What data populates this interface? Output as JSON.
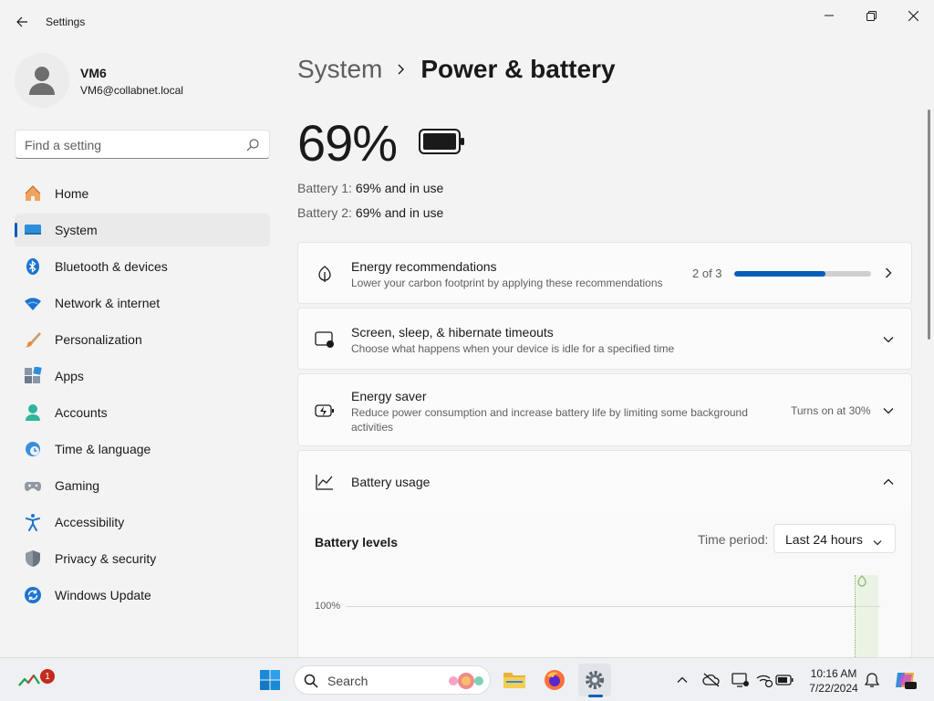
{
  "window": {
    "title": "Settings",
    "controls": [
      "minimize",
      "maximize",
      "close"
    ]
  },
  "profile": {
    "name": "VM6",
    "email": "VM6@collabnet.local"
  },
  "search": {
    "placeholder": "Find a setting"
  },
  "sidebar": {
    "items": [
      {
        "label": "Home",
        "icon": "home-icon"
      },
      {
        "label": "System",
        "icon": "system-icon",
        "active": true
      },
      {
        "label": "Bluetooth & devices",
        "icon": "bluetooth-icon"
      },
      {
        "label": "Network & internet",
        "icon": "wifi-icon"
      },
      {
        "label": "Personalization",
        "icon": "brush-icon"
      },
      {
        "label": "Apps",
        "icon": "apps-icon"
      },
      {
        "label": "Accounts",
        "icon": "accounts-icon"
      },
      {
        "label": "Time & language",
        "icon": "clock-globe-icon"
      },
      {
        "label": "Gaming",
        "icon": "gamepad-icon"
      },
      {
        "label": "Accessibility",
        "icon": "accessibility-icon"
      },
      {
        "label": "Privacy & security",
        "icon": "shield-icon"
      },
      {
        "label": "Windows Update",
        "icon": "update-icon"
      }
    ]
  },
  "breadcrumb": {
    "parent": "System",
    "current": "Power & battery"
  },
  "battery": {
    "percent_text": "69%",
    "lines": [
      {
        "label": "Battery 1:",
        "value": "69% and in use"
      },
      {
        "label": "Battery 2:",
        "value": "69% and in use"
      }
    ]
  },
  "cards": {
    "energy_recommendations": {
      "title": "Energy recommendations",
      "desc": "Lower your carbon footprint by applying these recommendations",
      "progress_text": "2 of 3",
      "progress_fraction": 0.667
    },
    "screen_sleep": {
      "title": "Screen, sleep, & hibernate timeouts",
      "desc": "Choose what happens when your device is idle for a specified time"
    },
    "energy_saver": {
      "title": "Energy saver",
      "desc": "Reduce power consumption and increase battery life by limiting some background activities",
      "status": "Turns on at 30%"
    },
    "battery_usage": {
      "title": "Battery usage"
    }
  },
  "battery_levels": {
    "title": "Battery levels",
    "period_label": "Time period:",
    "period_value": "Last 24 hours",
    "axis_label": "100%"
  },
  "taskbar": {
    "search_text": "Search",
    "notification_badge": "1",
    "time": "10:16 AM",
    "date": "7/22/2024"
  },
  "colors": {
    "accent": "#005fb8",
    "background": "#f3f3f3",
    "card": "#fbfbfb"
  }
}
